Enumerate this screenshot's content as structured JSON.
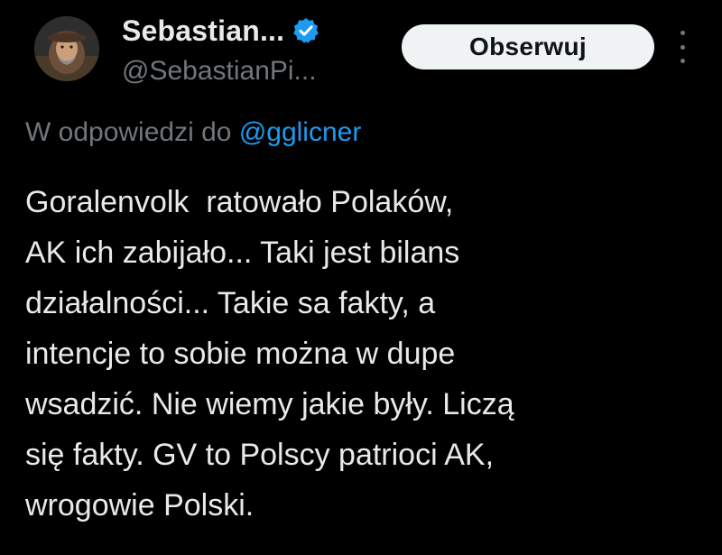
{
  "tweet": {
    "display_name": "Sebastian...",
    "handle": "@SebastianPi...",
    "follow_label": "Obserwuj",
    "reply_prefix": "W odpowiedzi do",
    "reply_mention": "@gglicner",
    "body_lines": [
      "Goralenvolk  ratowało Polaków,",
      "AK ich zabijało... Taki jest bilans",
      "działalności... Takie sa fakty, a",
      "intencje to sobie można w dupe",
      "wsadzić. Nie wiemy jakie były. Liczą",
      "się fakty. GV to Polscy patrioci AK,",
      "wrogowie Polski."
    ]
  },
  "icons": {
    "verified": "verified-badge-icon",
    "more": "more-options-icon"
  },
  "colors": {
    "background": "#000000",
    "text": "#e7e9ea",
    "secondary_text": "#71767b",
    "link": "#1d9bf0",
    "verified": "#1d9bf0",
    "follow_bg": "#eff3f4",
    "follow_text": "#0f1419"
  }
}
